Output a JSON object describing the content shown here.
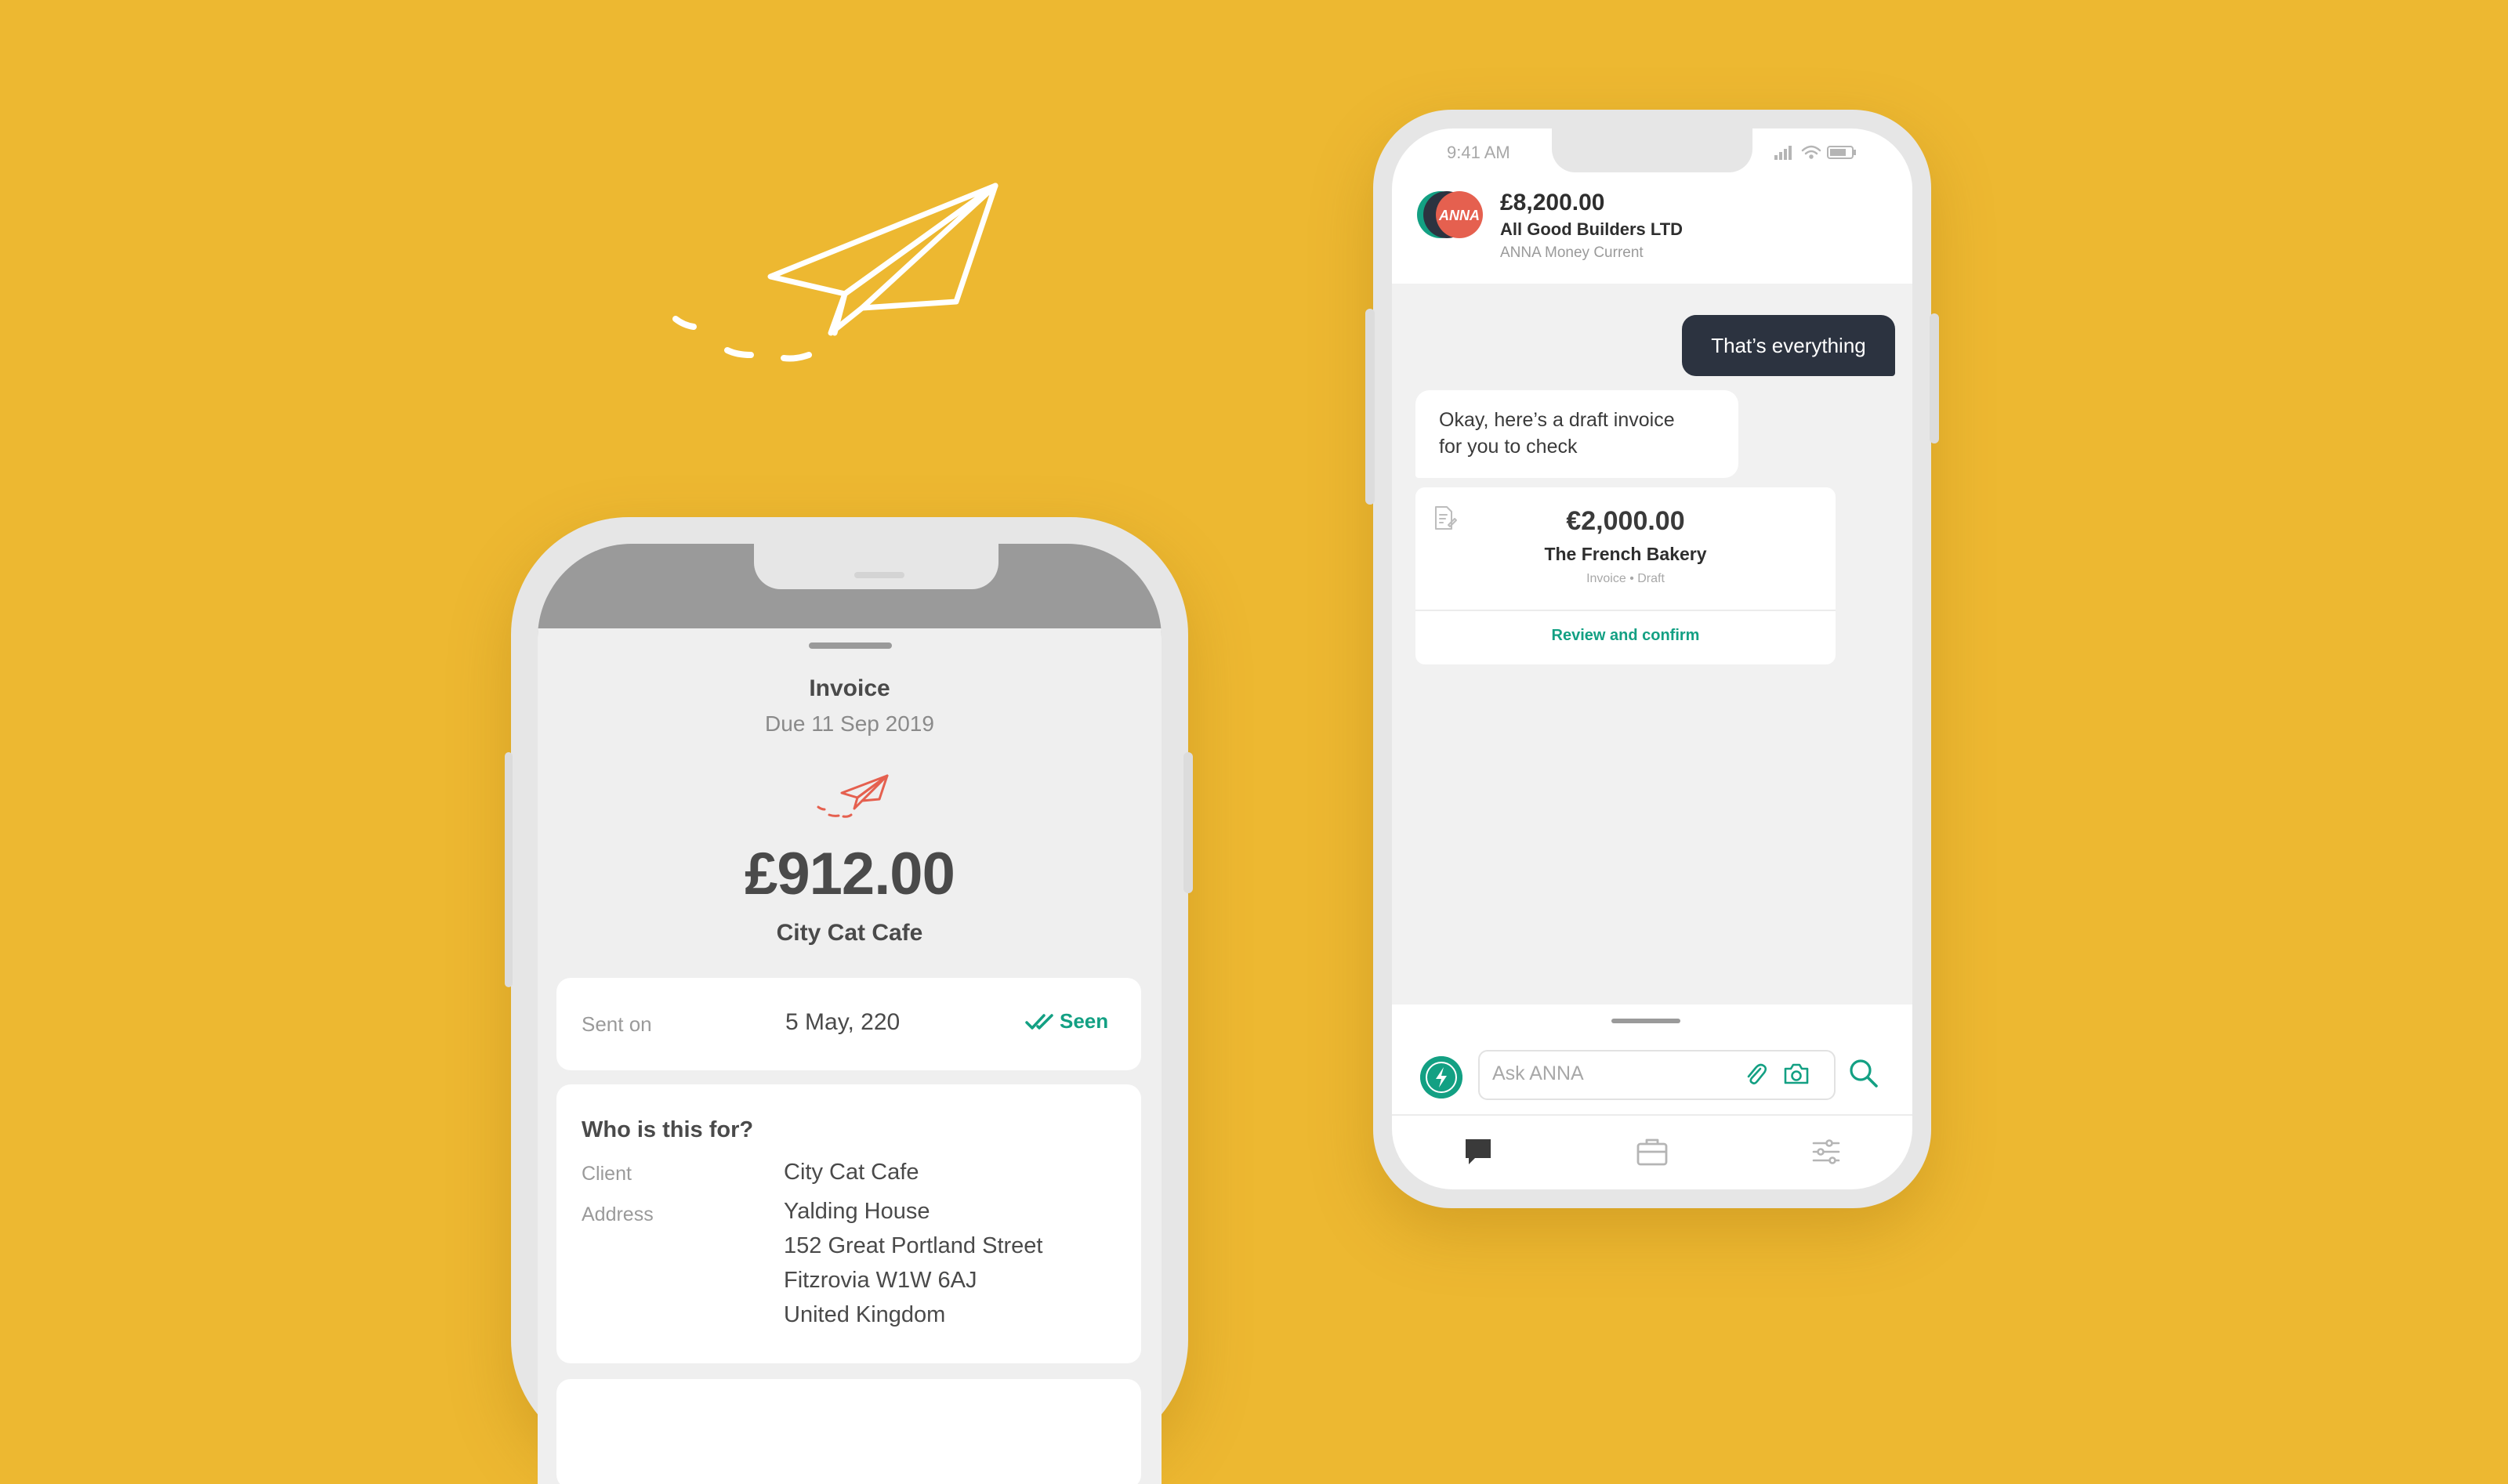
{
  "colors": {
    "background": "#EDB831",
    "accent_green": "#13A083",
    "accent_red": "#E5604F",
    "dark_bubble": "#2C3340"
  },
  "left_phone": {
    "invoice_title": "Invoice",
    "due_text": "Due 11 Sep 2019",
    "amount": "£912.00",
    "client_name": "City Cat Cafe",
    "sent": {
      "label": "Sent on",
      "date": "5 May, 220",
      "status": "Seen"
    },
    "who": {
      "title": "Who is this for?",
      "client_label": "Client",
      "client_value": "City Cat Cafe",
      "address_label": "Address",
      "address_lines": [
        "Yalding House",
        "152 Great Portland Street",
        "Fitzrovia W1W 6AJ",
        "United Kingdom"
      ]
    }
  },
  "right_phone": {
    "status_time": "9:41 AM",
    "header": {
      "avatar_text": "ANNA",
      "balance": "£8,200.00",
      "company": "All Good Builders LTD",
      "account": "ANNA Money Current"
    },
    "messages": {
      "user": "That’s everything",
      "bot_lines": [
        "Okay, here’s a draft invoice",
        "for you to check"
      ]
    },
    "invoice_card": {
      "amount": "€2,000.00",
      "company": "The French Bakery",
      "meta": "Invoice • Draft",
      "action": "Review and confirm"
    },
    "input": {
      "placeholder": "Ask ANNA"
    },
    "icons": [
      "bolt-icon",
      "paperclip-icon",
      "camera-icon",
      "search-icon",
      "chat-icon",
      "briefcase-icon",
      "settings-sliders-icon"
    ]
  }
}
